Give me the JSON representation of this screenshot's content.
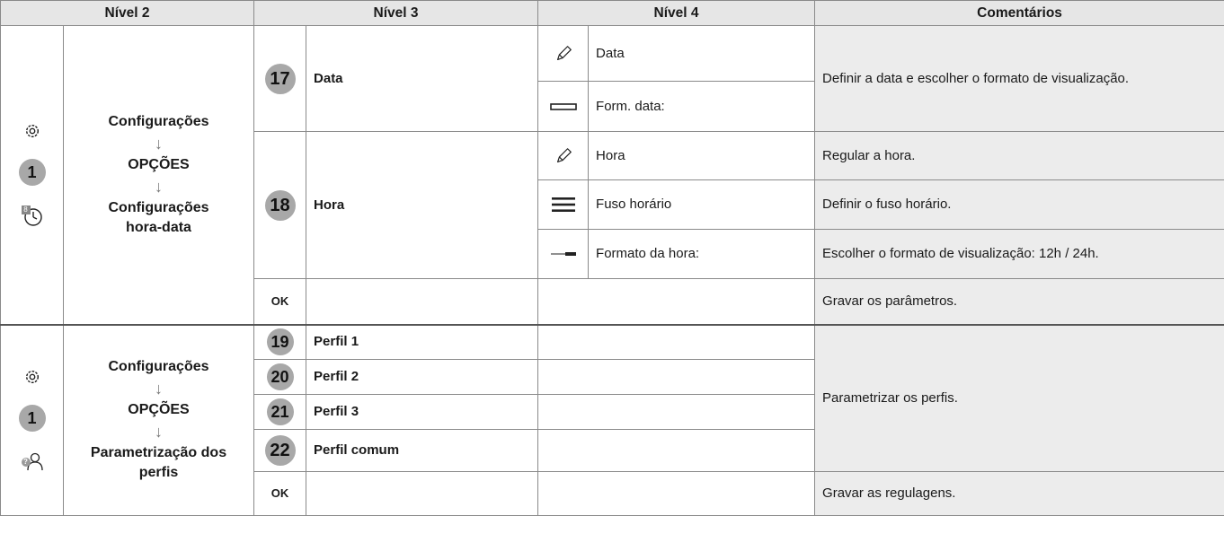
{
  "header": {
    "nivel2": "Nível 2",
    "nivel3": "Nível 3",
    "nivel4": "Nível 4",
    "comentarios": "Comentários"
  },
  "section1": {
    "step_number": "1",
    "menu": {
      "item1": "Configurações",
      "item2": "OPÇÕES",
      "item3_line1": "Configurações",
      "item3_line2": "hora-data",
      "arrow": "↓"
    },
    "rows": {
      "data": {
        "num": "17",
        "label": "Data"
      },
      "hora": {
        "num": "18",
        "label": "Hora"
      },
      "ok": {
        "label": "OK"
      }
    },
    "level4": {
      "data": "Data",
      "form_data": "Form. data:",
      "hora": "Hora",
      "fuso": "Fuso horário",
      "formato_hora": "Formato da hora:"
    },
    "comments": {
      "data": "Definir a data e escolher o formato de visualização.",
      "hora": "Regular a hora.",
      "fuso": "Definir o fuso horário.",
      "formato_hora": "Escolher o formato de visualização: 12h / 24h.",
      "ok": "Gravar os parâmetros."
    },
    "clock_badge": "8"
  },
  "section2": {
    "step_number": "1",
    "menu": {
      "item1": "Configurações",
      "item2": "OPÇÕES",
      "item3_line1": "Parametrização dos",
      "item3_line2": "perfis",
      "arrow": "↓"
    },
    "rows": {
      "p1": {
        "num": "19",
        "label": "Perfil 1"
      },
      "p2": {
        "num": "20",
        "label": "Perfil 2"
      },
      "p3": {
        "num": "21",
        "label": "Perfil 3"
      },
      "pc": {
        "num": "22",
        "label": "Perfil comum"
      },
      "ok": {
        "label": "OK"
      }
    },
    "comments": {
      "perfis": "Parametrizar os perfis.",
      "ok": "Gravar as regulagens."
    },
    "profile_badge": "?"
  },
  "icons": {
    "settings": "settings-gear-icon",
    "clock": "clock-icon",
    "pencil": "pencil-icon",
    "format": "date-format-icon",
    "menu": "hamburger-menu-icon",
    "slider": "slider-icon",
    "profile": "profile-help-icon"
  }
}
